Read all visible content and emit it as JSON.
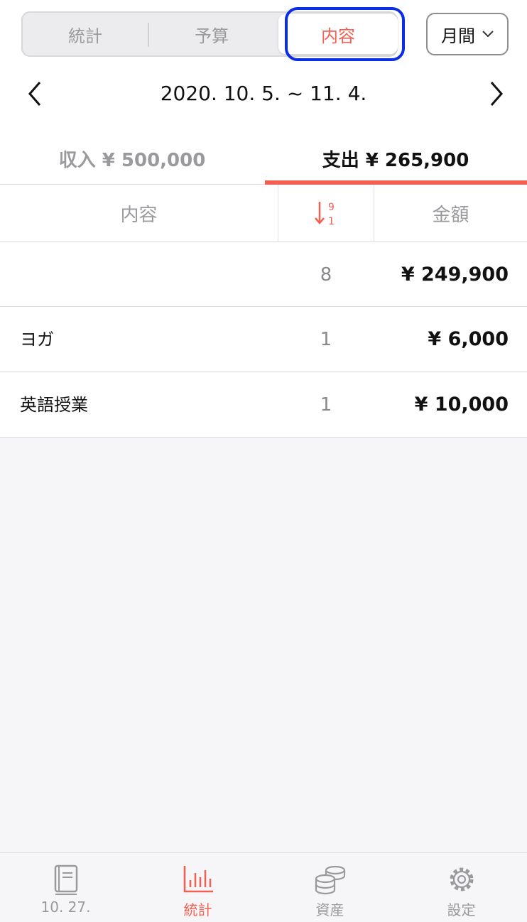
{
  "segments": {
    "stats": "統計",
    "budget": "予算",
    "content": "内容"
  },
  "period_button": "月間",
  "date_range": "2020. 10. 5. ~ 11. 4.",
  "tabs": {
    "income": "収入 ¥ 500,000",
    "expense": "支出 ¥ 265,900"
  },
  "table_header": {
    "content": "内容",
    "amount": "金額"
  },
  "rows": [
    {
      "name": "",
      "count": "8",
      "amount": "¥ 249,900"
    },
    {
      "name": "ヨガ",
      "count": "1",
      "amount": "¥ 6,000"
    },
    {
      "name": "英語授業",
      "count": "1",
      "amount": "¥ 10,000"
    }
  ],
  "tabbar": {
    "daily": "10. 27.",
    "stats": "統計",
    "assets": "資産",
    "settings": "設定"
  },
  "colors": {
    "accent": "#f26052",
    "focus": "#0a2ee6"
  }
}
